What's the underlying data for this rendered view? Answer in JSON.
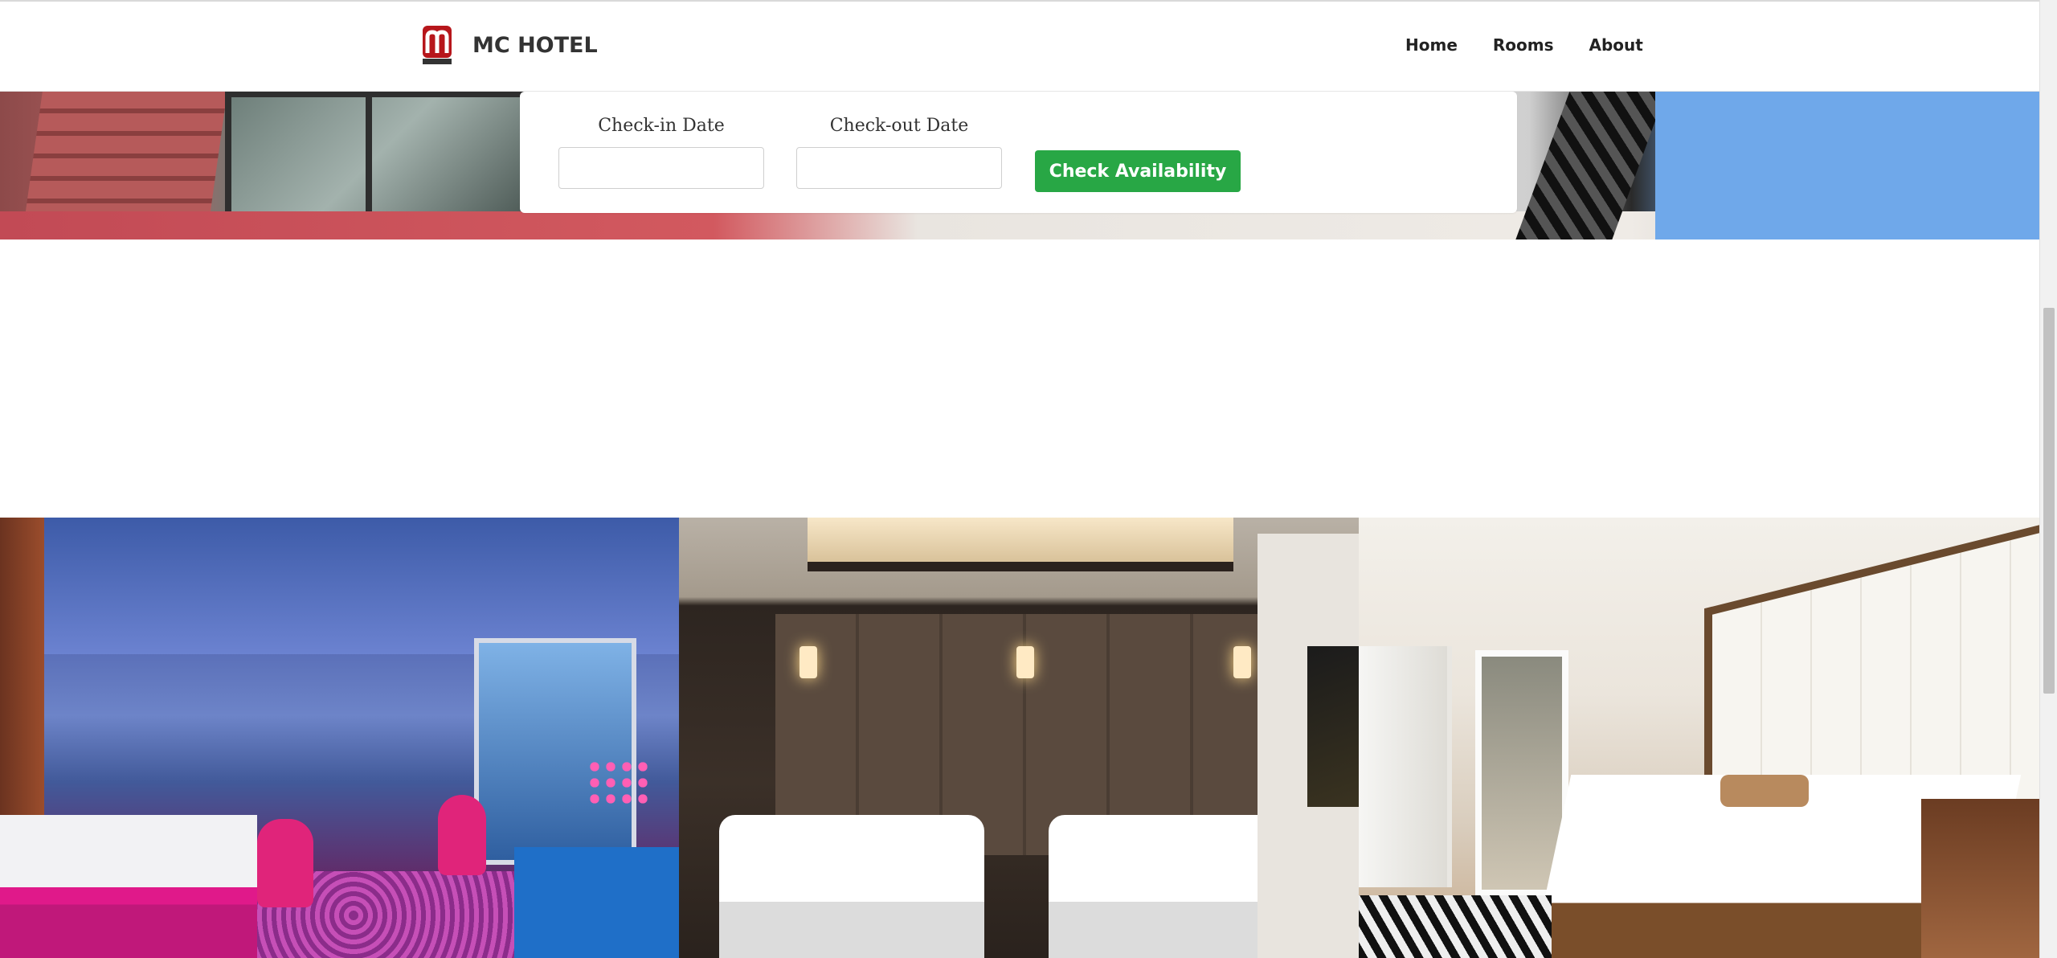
{
  "header": {
    "brand": "MC HOTEL",
    "logo_icon": "mc-hotel-logo-icon",
    "nav": [
      {
        "label": "Home"
      },
      {
        "label": "Rooms"
      },
      {
        "label": "About"
      }
    ]
  },
  "booking": {
    "checkin_label": "Check-in Date",
    "checkin_value": "",
    "checkout_label": "Check-out Date",
    "checkout_value": "",
    "submit_label": "Check Availability",
    "accent_color": "#28a745"
  },
  "gallery": {
    "rooms": [
      {
        "name": "blue-suite-image"
      },
      {
        "name": "twin-room-image"
      },
      {
        "name": "white-luxury-room-image"
      }
    ]
  }
}
